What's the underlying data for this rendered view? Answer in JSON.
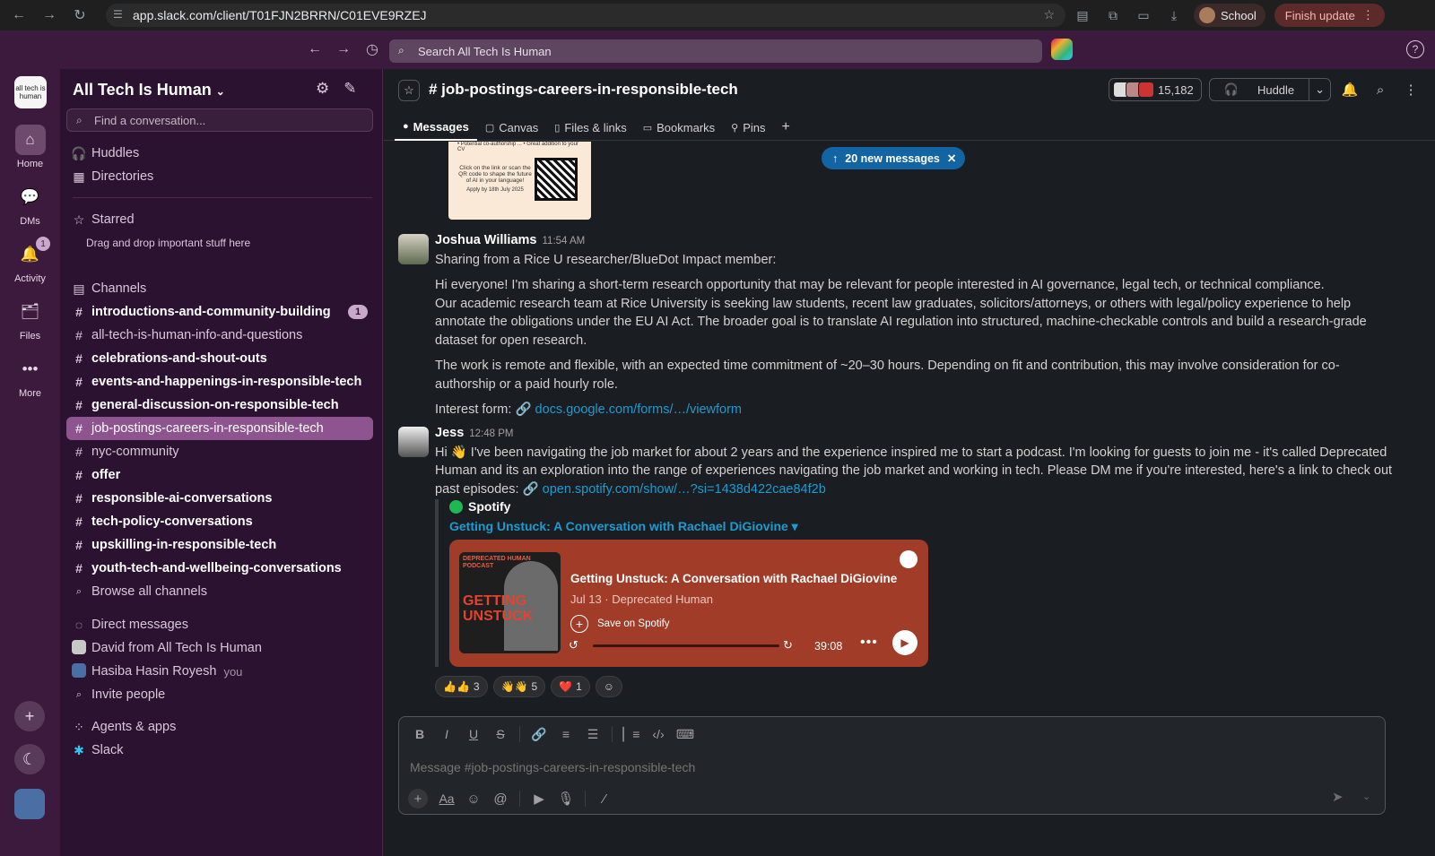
{
  "browser": {
    "url": "app.slack.com/client/T01FJN2BRRN/C01EVE9RZEJ",
    "profile": "School",
    "update": "Finish update"
  },
  "topbar": {
    "search_placeholder": "Search All Tech Is Human"
  },
  "rail": {
    "workspace_logo_text": "all tech is human",
    "items": [
      {
        "label": "Home"
      },
      {
        "label": "DMs"
      },
      {
        "label": "Activity",
        "badge": "1"
      },
      {
        "label": "Files"
      },
      {
        "label": "More"
      }
    ]
  },
  "sidebar": {
    "workspace": "All Tech Is Human",
    "find_placeholder": "Find a conversation...",
    "top_items": [
      "Huddles",
      "Directories"
    ],
    "starred": {
      "label": "Starred",
      "hint": "Drag and drop important stuff here"
    },
    "channels_header": "Channels",
    "channels": [
      {
        "name": "introductions-and-community-building",
        "badge": "1"
      },
      {
        "name": "all-tech-is-human-info-and-questions"
      },
      {
        "name": "celebrations-and-shout-outs"
      },
      {
        "name": "events-and-happenings-in-responsible-tech"
      },
      {
        "name": "general-discussion-on-responsible-tech"
      },
      {
        "name": "job-postings-careers-in-responsible-tech"
      },
      {
        "name": "nyc-community"
      },
      {
        "name": "offer"
      },
      {
        "name": "responsible-ai-conversations"
      },
      {
        "name": "tech-policy-conversations"
      },
      {
        "name": "upskilling-in-responsible-tech"
      },
      {
        "name": "youth-tech-and-wellbeing-conversations"
      }
    ],
    "browse_channels": "Browse all channels",
    "dm_header": "Direct messages",
    "dms": [
      {
        "name": "David from All Tech Is Human"
      },
      {
        "name": "Hasiba Hasin Royesh",
        "suffix": "you"
      }
    ],
    "invite": "Invite people",
    "apps_header": "Agents & apps",
    "apps": [
      "Slack"
    ]
  },
  "channel": {
    "name": "# job-postings-careers-in-responsible-tech",
    "member_count": "15,182",
    "huddle": "Huddle",
    "tabs": [
      "Messages",
      "Canvas",
      "Files & links",
      "Bookmarks",
      "Pins"
    ],
    "new_messages": "20 new messages"
  },
  "poster": {
    "text_top": "• Potential co-authorship ... • Great addition to your CV",
    "text_mid": "Click on the link or scan the QR code to shape the future of AI in your language!",
    "text_bottom": "Apply by 18th July 2025"
  },
  "messages": [
    {
      "author": "Joshua Williams",
      "time": "11:54 AM",
      "lines": [
        "Sharing from a Rice U researcher/BlueDot Impact member:",
        "Hi everyone! I'm sharing a short-term research opportunity that may be relevant for people interested in AI governance, legal tech, or technical compliance.",
        "Our academic research team at Rice University is seeking law students, recent law graduates, solicitors/attorneys, or others with legal/policy experience to help annotate the obligations under the EU AI Act. The broader goal is to translate AI regulation into structured, machine-checkable controls and build a research-grade dataset for open research.",
        "The work is remote and flexible, with an expected time commitment of ~20–30 hours. Depending on fit and contribution, this may involve consideration for co-authorship or a paid hourly role."
      ],
      "interest_label": "Interest form:",
      "interest_link": "docs.google.com/forms/…/viewform"
    },
    {
      "author": "Jess",
      "time": "12:48 PM",
      "text": "Hi 👋 I've been navigating the job market for about 2 years and the experience inspired me to start a podcast. I'm looking for guests to join me - it's called Deprecated Human and its an exploration into the range of experiences navigating the job market and working in tech. Please DM me if you're interested, here's a link to check out past episodes:",
      "link": "open.spotify.com/show/…?si=1438d422cae84f2b",
      "unfurl": {
        "source": "Spotify",
        "title": "Getting Unstuck: A Conversation with Rachael DiGiovine ▾",
        "player_title": "Getting Unstuck: A Conversation with Rachael DiGiovine",
        "player_sub": "Jul 13 · Deprecated Human",
        "save": "Save on Spotify",
        "duration": "39:08",
        "cover_top": "DEPRECATED HUMAN PODCAST",
        "cover_main": "GETTING UNSTUCK"
      },
      "reactions": [
        {
          "emoji": "👍👍",
          "count": "3"
        },
        {
          "emoji": "👋👋",
          "count": "5"
        },
        {
          "emoji": "❤️",
          "count": "1"
        }
      ]
    }
  ],
  "composer": {
    "placeholder": "Message #job-postings-careers-in-responsible-tech"
  },
  "colors": {
    "aubergine": "#3b1a3d",
    "sidebar": "#2b1230",
    "selected": "#8e548f",
    "link": "#1d9bd1",
    "spotify_card": "#a03c28"
  }
}
